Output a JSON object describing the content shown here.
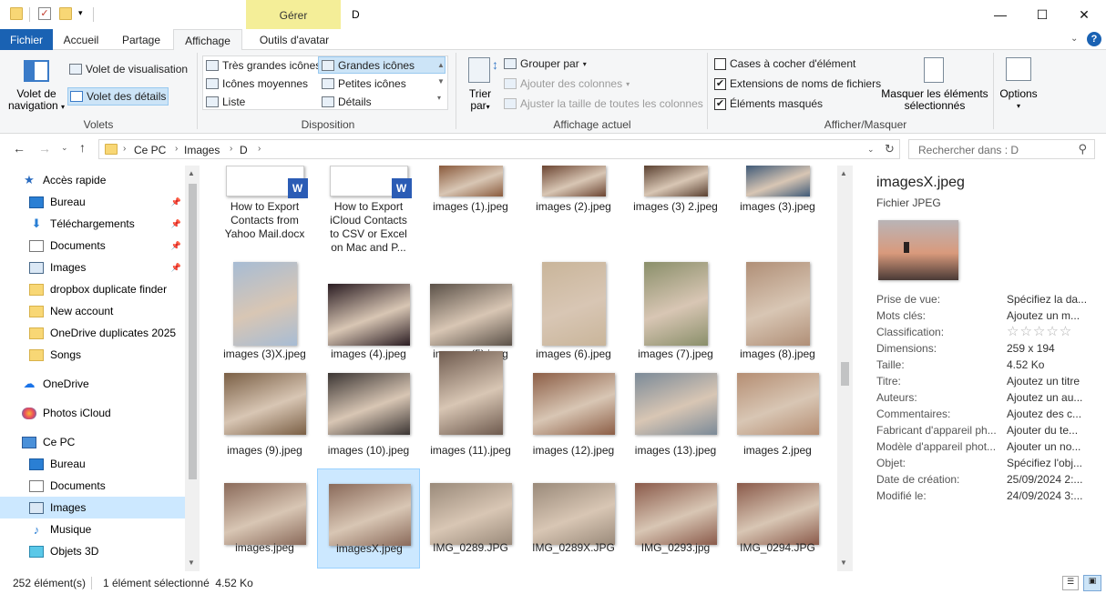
{
  "window": {
    "title": "D",
    "context_tab": "Gérer",
    "minimize": "—",
    "maximize": "☐",
    "close": "✕"
  },
  "tabs": [
    "Fichier",
    "Accueil",
    "Partage",
    "Affichage",
    "Outils d'avatar"
  ],
  "ribbon": {
    "volets": {
      "nav_pane_label_1": "Volet de",
      "nav_pane_label_2": "navigation",
      "preview_pane": "Volet de visualisation",
      "details_pane": "Volet des détails",
      "group": "Volets"
    },
    "disposition": {
      "items": [
        "Très grandes icônes",
        "Grandes icônes",
        "Icônes moyennes",
        "Petites icônes",
        "Liste",
        "Détails"
      ],
      "selected": "Grandes icônes",
      "group": "Disposition"
    },
    "affichage": {
      "sort_1": "Trier",
      "sort_2": "par",
      "group_by": "Grouper par",
      "add_columns": "Ajouter des colonnes",
      "fit_columns": "Ajuster la taille de toutes les colonnes",
      "group": "Affichage actuel"
    },
    "afficher": {
      "checkboxes": [
        {
          "label": "Cases à cocher d'élément",
          "checked": false
        },
        {
          "label": "Extensions de noms de fichiers",
          "checked": true
        },
        {
          "label": "Éléments masqués",
          "checked": true
        }
      ],
      "hide_selected_1": "Masquer les éléments",
      "hide_selected_2": "sélectionnés",
      "options": "Options",
      "group": "Afficher/Masquer"
    }
  },
  "address": {
    "crumbs": [
      "Ce PC",
      "Images",
      "D"
    ],
    "search_placeholder": "Rechercher dans : D"
  },
  "nav": {
    "items": [
      {
        "label": "Accès rapide",
        "icon": "star-icon",
        "pinned": false
      },
      {
        "label": "Bureau",
        "icon": "desktop-icon",
        "pinned": true
      },
      {
        "label": "Téléchargements",
        "icon": "download-icon",
        "pinned": true
      },
      {
        "label": "Documents",
        "icon": "document-icon",
        "pinned": true
      },
      {
        "label": "Images",
        "icon": "pictures-icon",
        "pinned": true
      },
      {
        "label": "dropbox duplicate finder",
        "icon": "folder-icon",
        "pinned": false
      },
      {
        "label": "New account",
        "icon": "folder-icon",
        "pinned": false
      },
      {
        "label": "OneDrive duplicates 2025",
        "icon": "folder-icon",
        "pinned": false
      },
      {
        "label": "Songs",
        "icon": "folder-icon",
        "pinned": false
      },
      {
        "label": "OneDrive",
        "icon": "cloud-icon",
        "pinned": false
      },
      {
        "label": "Photos iCloud",
        "icon": "photos-icon",
        "pinned": false
      },
      {
        "label": "Ce PC",
        "icon": "computer-icon",
        "pinned": false
      },
      {
        "label": "Bureau",
        "icon": "desktop-icon",
        "pinned": false
      },
      {
        "label": "Documents",
        "icon": "document-icon",
        "pinned": false
      },
      {
        "label": "Images",
        "icon": "pictures-icon",
        "pinned": false
      },
      {
        "label": "Musique",
        "icon": "music-icon",
        "pinned": false
      },
      {
        "label": "Objets 3D",
        "icon": "cube-icon",
        "pinned": false
      }
    ],
    "selected": "Images"
  },
  "files": [
    {
      "name": "How to Export Contacts from Yahoo Mail.docx",
      "lines": [
        "How to Export",
        "Contacts from",
        "Yahoo Mail.docx"
      ],
      "kind": "docx"
    },
    {
      "name": "How to Export iCloud Contacts to CSV or Excel on Mac and P...",
      "lines": [
        "How to Export",
        "iCloud Contacts",
        "to CSV or Excel",
        "on Mac and P..."
      ],
      "kind": "docx"
    },
    {
      "name": "images (1).jpeg",
      "lines": [
        "images (1).jpeg"
      ],
      "kind": "photo",
      "color": "#8a5a3c"
    },
    {
      "name": "images (2).jpeg",
      "lines": [
        "images (2).jpeg"
      ],
      "kind": "photo",
      "color": "#6b4431"
    },
    {
      "name": "images (3) 2.jpeg",
      "lines": [
        "images (3) 2.jpeg"
      ],
      "kind": "photo",
      "color": "#5a4030"
    },
    {
      "name": "images (3).jpeg",
      "lines": [
        "images (3).jpeg"
      ],
      "kind": "photo",
      "color": "#3f5a78"
    },
    {
      "name": "images (3)X.jpeg",
      "lines": [
        "images (3)X.jpeg"
      ],
      "kind": "photo",
      "color": "#a7bcd4"
    },
    {
      "name": "images (4).jpeg",
      "lines": [
        "images (4).jpeg"
      ],
      "kind": "photo",
      "color": "#2a1c22"
    },
    {
      "name": "images (5).jpeg",
      "lines": [
        "images (5).jpeg"
      ],
      "kind": "photo",
      "color": "#5b5148"
    },
    {
      "name": "images (6).jpeg",
      "lines": [
        "images (6).jpeg"
      ],
      "kind": "photo",
      "color": "#c9b59a"
    },
    {
      "name": "images (7).jpeg",
      "lines": [
        "images (7).jpeg"
      ],
      "kind": "photo",
      "color": "#8a8f6a"
    },
    {
      "name": "images (8).jpeg",
      "lines": [
        "images (8).jpeg"
      ],
      "kind": "photo",
      "color": "#b08f77"
    },
    {
      "name": "images (9).jpeg",
      "lines": [
        "images (9).jpeg"
      ],
      "kind": "photo",
      "color": "#7a5f45"
    },
    {
      "name": "images (10).jpeg",
      "lines": [
        "images (10).jpeg"
      ],
      "kind": "photo",
      "color": "#3b3533"
    },
    {
      "name": "images (11).jpeg",
      "lines": [
        "images (11).jpeg"
      ],
      "kind": "photo",
      "color": "#6e5a4e"
    },
    {
      "name": "images (12).jpeg",
      "lines": [
        "images (12).jpeg"
      ],
      "kind": "photo",
      "color": "#8c5e46"
    },
    {
      "name": "images (13).jpeg",
      "lines": [
        "images (13).jpeg"
      ],
      "kind": "photo",
      "color": "#7b8a98"
    },
    {
      "name": "images 2.jpeg",
      "lines": [
        "images 2.jpeg"
      ],
      "kind": "photo",
      "color": "#b58e73"
    },
    {
      "name": "images.jpeg",
      "lines": [
        "images.jpeg"
      ],
      "kind": "photo",
      "color": "#8a6a5a"
    },
    {
      "name": "imagesX.jpeg",
      "lines": [
        "imagesX.jpeg"
      ],
      "kind": "photo",
      "color": "#8a6a5a"
    },
    {
      "name": "IMG_0289.JPG",
      "lines": [
        "IMG_0289.JPG"
      ],
      "kind": "photo",
      "color": "#9a8a7a"
    },
    {
      "name": "IMG_0289X.JPG",
      "lines": [
        "IMG_0289X.JPG"
      ],
      "kind": "photo",
      "color": "#9a8a7a"
    },
    {
      "name": "IMG_0293.jpg",
      "lines": [
        "IMG_0293.jpg"
      ],
      "kind": "photo",
      "color": "#8a5a4a"
    },
    {
      "name": "IMG_0294.JPG",
      "lines": [
        "IMG_0294.JPG"
      ],
      "kind": "photo",
      "color": "#8a5a4a"
    }
  ],
  "selected_file": "imagesX.jpeg",
  "details": {
    "title": "imagesX.jpeg",
    "type": "Fichier JPEG",
    "props": [
      {
        "name": "Prise de vue:",
        "value": "Spécifiez la da..."
      },
      {
        "name": "Mots clés:",
        "value": "Ajoutez un m..."
      },
      {
        "name": "Classification:",
        "value": "☆☆☆☆☆"
      },
      {
        "name": "Dimensions:",
        "value": "259 x 194"
      },
      {
        "name": "Taille:",
        "value": "4.52 Ko"
      },
      {
        "name": "Titre:",
        "value": "Ajoutez un titre"
      },
      {
        "name": "Auteurs:",
        "value": "Ajoutez un au..."
      },
      {
        "name": "Commentaires:",
        "value": "Ajoutez des c..."
      },
      {
        "name": "Fabricant d'appareil ph...",
        "value": "Ajouter du te..."
      },
      {
        "name": "Modèle d'appareil phot...",
        "value": "Ajouter un no..."
      },
      {
        "name": "Objet:",
        "value": "Spécifiez l'obj..."
      },
      {
        "name": "Date de création:",
        "value": "25/09/2024 2:..."
      },
      {
        "name": "Modifié le:",
        "value": "24/09/2024 3:..."
      }
    ]
  },
  "status": {
    "count": "252 élément(s)",
    "selection": "1 élément sélectionné  4.52 Ko"
  },
  "colors": {
    "file_tab": "#1a62b3",
    "context_tab": "#f4ee98",
    "selection": "#cce8ff",
    "ribbon_bg": "#f5f6f7"
  }
}
